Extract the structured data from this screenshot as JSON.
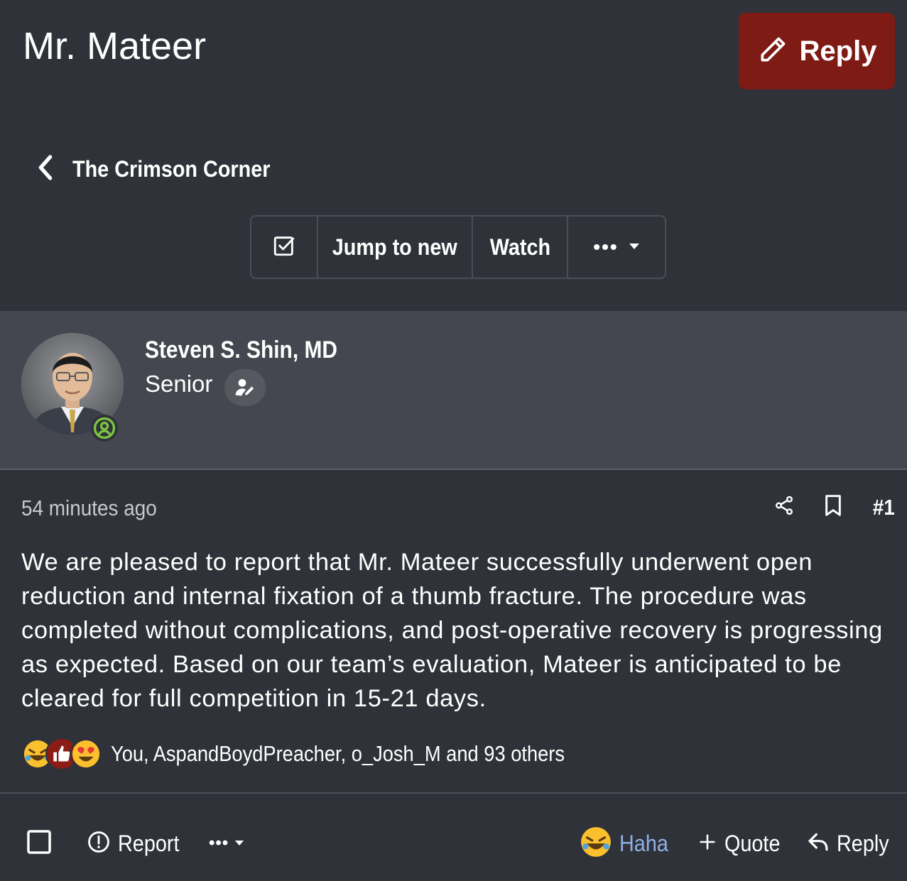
{
  "thread": {
    "title": "Mr. Mateer",
    "reply_label": "Reply",
    "breadcrumb_label": "The Crimson Corner"
  },
  "toolbar": {
    "select_icon": "checkbox-icon",
    "jump_label": "Jump to new",
    "watch_label": "Watch",
    "more_label": "•••"
  },
  "author": {
    "name": "Steven S. Shin, MD",
    "title": "Senior",
    "status_icon": "online-user-icon",
    "role_icon": "user-edit-icon"
  },
  "post": {
    "time": "54 minutes ago",
    "number": "#1",
    "body": "We are pleased to report that Mr. Mateer successfully underwent open reduction and internal fixation of a thumb fracture. The procedure was completed without complications, and post-operative recovery is progressing as expected. Based on our team’s evaluation, Mateer is anticipated to be cleared for full competition in 15-21 days.",
    "reactions": {
      "icons": [
        "haha-emoji",
        "like-emoji",
        "love-emoji"
      ],
      "summary": "You, AspandBoydPreacher, o_Josh_M and 93 others"
    }
  },
  "actions": {
    "report_label": "Report",
    "more_label": "•••",
    "haha_label": "Haha",
    "quote_label": "Quote",
    "reply_label": "Reply"
  },
  "colors": {
    "background": "#2f3238",
    "author_bar": "#44474f",
    "reply_button": "#7e1b14",
    "haha_text": "#8fb0e6",
    "status_green": "#7cc243"
  }
}
